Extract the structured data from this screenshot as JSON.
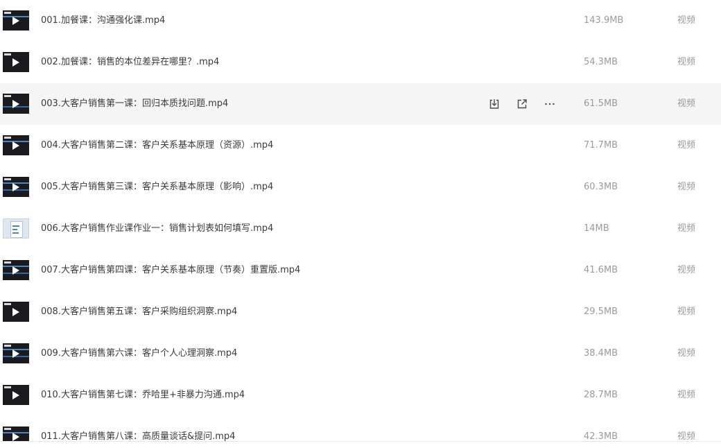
{
  "files": [
    {
      "name": "001.加餐课：沟通强化课.mp4",
      "size": "143.9MB",
      "type": "视频",
      "thumb": "video"
    },
    {
      "name": "002.加餐课：销售的本位差异在哪里？.mp4",
      "size": "54.3MB",
      "type": "视频",
      "thumb": "video"
    },
    {
      "name": "003.大客户销售第一课：回归本质找问题.mp4",
      "size": "61.5MB",
      "type": "视频",
      "thumb": "video"
    },
    {
      "name": "004.大客户销售第二课：客户关系基本原理（资源）.mp4",
      "size": "71.7MB",
      "type": "视频",
      "thumb": "video"
    },
    {
      "name": "005.大客户销售第三课：客户关系基本原理（影响）.mp4",
      "size": "60.3MB",
      "type": "视频",
      "thumb": "video"
    },
    {
      "name": "006.大客户销售作业课作业一：销售计划表如何填写.mp4",
      "size": "14MB",
      "type": "视频",
      "thumb": "document"
    },
    {
      "name": "007.大客户销售第四课：客户关系基本原理（节奏）重置版.mp4",
      "size": "41.6MB",
      "type": "视频",
      "thumb": "video"
    },
    {
      "name": "008.大客户销售第五课：客户采购组织洞察.mp4",
      "size": "29.5MB",
      "type": "视频",
      "thumb": "video"
    },
    {
      "name": "009.大客户销售第六课：客户个人心理洞察.mp4",
      "size": "38.4MB",
      "type": "视频",
      "thumb": "video"
    },
    {
      "name": "010.大客户销售第七课：乔哈里+非暴力沟通.mp4",
      "size": "28.7MB",
      "type": "视频",
      "thumb": "video"
    },
    {
      "name": "011.大客户销售第八课：高质量谈话&提问.mp4",
      "size": "42.3MB",
      "type": "视频",
      "thumb": "video"
    }
  ],
  "hover_actions": {
    "download_icon": "download-icon",
    "share_icon": "share-icon",
    "more_icon": "more-icon"
  },
  "colors": {
    "row_highlight": "#f5f5f6",
    "name_text": "#3a3a3a",
    "meta_text": "#9a9a9a"
  }
}
